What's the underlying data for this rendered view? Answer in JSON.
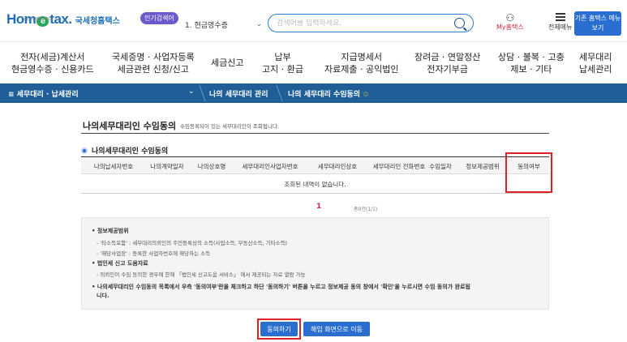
{
  "header": {
    "logo_subtitle": "국민이 행복해지는",
    "logo_text_1": "Hom",
    "logo_text_e": "e",
    "logo_text_2": "tax.",
    "logo_korean": "국세청홈택스",
    "popular_badge": "인기검색어",
    "popular_selected": "1. 현금영수증",
    "search_placeholder": "검색어를 입력하세요.",
    "my_hometax": "My홈택스",
    "all_menu": "전체메뉴",
    "old_hometax": "기존 홈택스 메뉴 보기"
  },
  "gnb": {
    "items": [
      {
        "line1": "전자(세금)계산서",
        "line2": "현금영수증 · 신용카드"
      },
      {
        "line1": "국세증명 · 사업자등록",
        "line2": "세금관련 신청/신고"
      },
      {
        "line1": "세금신고",
        "line2": ""
      },
      {
        "line1": "납부",
        "line2": "고지 · 환급"
      },
      {
        "line1": "지급명세서",
        "line2": "자료제출 · 공익법인"
      },
      {
        "line1": "장려금 · 연말정산",
        "line2": "전자기부금"
      },
      {
        "line1": "상담 · 불복 · 고충",
        "line2": "제보 · 기타"
      },
      {
        "line1": "세무대리",
        "line2": "납세관리"
      }
    ]
  },
  "breadcrumb": {
    "menu_label": "≡  세무대리 · 납세관리",
    "level2": "나의 세무대리 관리",
    "level3": "나의 세무대리 수임동의"
  },
  "page": {
    "title": "나의세무대리인 수임동의",
    "description": "수임등록되어 있는 세무대리인이 조회됩니다.",
    "section_title": "나의세무대리인 수임동의"
  },
  "table": {
    "headers": [
      "나의납세자번호",
      "나의계약일자",
      "나의상호명",
      "세무대리인사업자번호",
      "세무대리인상호",
      "세무대리인 전화번호",
      "수임일자",
      "정보제공범위",
      "동의여부"
    ],
    "empty_message": "조회된 내역이 없습니다."
  },
  "pagination": {
    "current_page": "1",
    "count_text": "총0건(1/1)"
  },
  "info": {
    "lines": [
      "• 정보제공범위",
      "- '타소득포함' : 세무대리의뢰인의 주민등록상의 소득(사업소득, 부동산소득, 기타소득)",
      "- '해당사업장' : 등록한 사업자번호에 해당하는 소득",
      "• 법인세 신고 도움자료",
      "- 의뢰인이 수임 동의한 경우에 한해 「법인세 신고도움 서비스」 에서 제공되는 자료 열람 가능",
      "• 나의세무대리인 수임동의 목록에서 우측 '동의여부'란을 체크하고 하단 '동의하기' 버튼을 누르고 정보제공 동의 창에서 '확인'을 누르시면 수임 동의가 완료됩",
      "니다."
    ]
  },
  "buttons": {
    "agree": "동의하기",
    "cancel": "해임 화면으로 이동"
  },
  "colors": {
    "primary_blue": "#2a6fd0",
    "breadcrumb_bg": "#1f5e99",
    "highlight_red": "#e0202a"
  }
}
